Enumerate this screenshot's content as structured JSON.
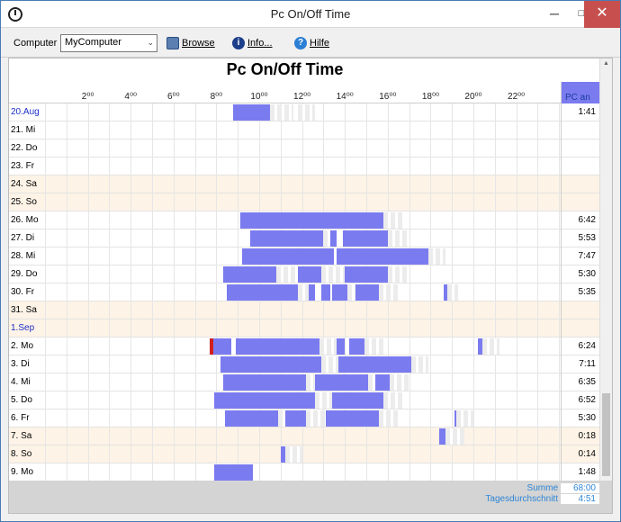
{
  "window": {
    "title": "Pc On/Off Time",
    "min": "─",
    "max": "□",
    "close": "✕"
  },
  "toolbar": {
    "computer_label": "Computer",
    "computer_value": "MyComputer",
    "browse_label": "Browse",
    "info_label": "Info...",
    "help_label": "Hilfe"
  },
  "chart": {
    "title": "Pc On/Off Time",
    "hours": [
      "2⁰⁰",
      "4⁰⁰",
      "6⁰⁰",
      "8⁰⁰",
      "10⁰⁰",
      "12⁰⁰",
      "14⁰⁰",
      "16⁰⁰",
      "18⁰⁰",
      "20⁰⁰",
      "22⁰⁰"
    ],
    "total_header": "PC an",
    "colors": {
      "on": "#7b7bf0",
      "weekend": "#fdf3e6",
      "red": "#d02020"
    },
    "days": [
      {
        "label": "20.Aug",
        "blue": true,
        "weekend": false,
        "total": "1:41",
        "on": [
          [
            8.8,
            10.5
          ]
        ],
        "fade": [
          [
            10.5,
            11.6
          ],
          [
            11.8,
            12.6
          ]
        ],
        "red": []
      },
      {
        "label": "21. Mi",
        "blue": false,
        "weekend": false,
        "total": "",
        "on": [],
        "fade": [],
        "red": []
      },
      {
        "label": "22. Do",
        "blue": false,
        "weekend": false,
        "total": "",
        "on": [],
        "fade": [],
        "red": []
      },
      {
        "label": "23. Fr",
        "blue": false,
        "weekend": false,
        "total": "",
        "on": [],
        "fade": [],
        "red": []
      },
      {
        "label": "24. Sa",
        "blue": false,
        "weekend": true,
        "total": "",
        "on": [],
        "fade": [],
        "red": []
      },
      {
        "label": "25. So",
        "blue": false,
        "weekend": true,
        "total": "",
        "on": [],
        "fade": [],
        "red": []
      },
      {
        "label": "26. Mo",
        "blue": false,
        "weekend": false,
        "total": "6:42",
        "on": [
          [
            9.1,
            15.8
          ]
        ],
        "fade": [
          [
            15.8,
            16.8
          ]
        ],
        "red": []
      },
      {
        "label": "27. Di",
        "blue": false,
        "weekend": false,
        "total": "5:53",
        "on": [
          [
            9.6,
            13.0
          ],
          [
            13.3,
            13.6
          ],
          [
            13.9,
            16.0
          ]
        ],
        "fade": [
          [
            13.0,
            13.3
          ],
          [
            16.0,
            17.0
          ]
        ],
        "red": []
      },
      {
        "label": "28. Mi",
        "blue": false,
        "weekend": false,
        "total": "7:47",
        "on": [
          [
            9.2,
            13.5
          ],
          [
            13.6,
            17.9
          ]
        ],
        "fade": [
          [
            17.9,
            18.7
          ]
        ],
        "red": []
      },
      {
        "label": "29. Do",
        "blue": false,
        "weekend": false,
        "total": "5:30",
        "on": [
          [
            8.3,
            10.8
          ],
          [
            11.8,
            12.9
          ],
          [
            14.0,
            16.0
          ]
        ],
        "fade": [
          [
            10.8,
            11.8
          ],
          [
            12.9,
            14.0
          ],
          [
            16.0,
            16.9
          ]
        ],
        "red": []
      },
      {
        "label": "30. Fr",
        "blue": false,
        "weekend": false,
        "total": "5:35",
        "on": [
          [
            8.5,
            11.8
          ],
          [
            12.3,
            12.6
          ],
          [
            12.9,
            13.3
          ],
          [
            13.4,
            14.1
          ],
          [
            14.5,
            15.6
          ],
          [
            18.6,
            18.8
          ]
        ],
        "fade": [
          [
            11.8,
            12.3
          ],
          [
            14.1,
            14.5
          ],
          [
            15.6,
            16.6
          ],
          [
            18.8,
            19.3
          ]
        ],
        "red": []
      },
      {
        "label": "31. Sa",
        "blue": false,
        "weekend": true,
        "total": "",
        "on": [],
        "fade": [],
        "red": []
      },
      {
        "label": "1.Sep",
        "blue": true,
        "weekend": true,
        "total": "",
        "on": [],
        "fade": [],
        "red": []
      },
      {
        "label": "2. Mo",
        "blue": false,
        "weekend": false,
        "total": "6:24",
        "on": [
          [
            7.8,
            8.7
          ],
          [
            8.9,
            12.8
          ],
          [
            13.6,
            14.0
          ],
          [
            14.2,
            14.9
          ],
          [
            20.2,
            20.4
          ]
        ],
        "fade": [
          [
            12.8,
            13.6
          ],
          [
            14.9,
            15.8
          ],
          [
            20.4,
            21.2
          ]
        ],
        "red": [
          [
            7.7,
            7.8
          ]
        ]
      },
      {
        "label": "3. Di",
        "blue": false,
        "weekend": false,
        "total": "7:11",
        "on": [
          [
            8.2,
            12.9
          ],
          [
            13.7,
            17.1
          ]
        ],
        "fade": [
          [
            12.9,
            13.7
          ],
          [
            17.1,
            17.9
          ]
        ],
        "red": []
      },
      {
        "label": "4. Mi",
        "blue": false,
        "weekend": false,
        "total": "6:35",
        "on": [
          [
            8.3,
            12.2
          ],
          [
            12.6,
            15.1
          ],
          [
            15.4,
            16.1
          ]
        ],
        "fade": [
          [
            12.2,
            12.6
          ],
          [
            15.1,
            15.4
          ],
          [
            16.1,
            17.0
          ]
        ],
        "red": []
      },
      {
        "label": "5. Do",
        "blue": false,
        "weekend": false,
        "total": "6:52",
        "on": [
          [
            7.9,
            12.6
          ],
          [
            13.4,
            15.8
          ]
        ],
        "fade": [
          [
            12.6,
            13.4
          ],
          [
            15.8,
            16.8
          ]
        ],
        "red": []
      },
      {
        "label": "6. Fr",
        "blue": false,
        "weekend": false,
        "total": "5:30",
        "on": [
          [
            8.4,
            10.9
          ],
          [
            11.2,
            12.2
          ],
          [
            13.1,
            15.6
          ],
          [
            19.1,
            19.2
          ]
        ],
        "fade": [
          [
            10.9,
            11.2
          ],
          [
            12.2,
            13.1
          ],
          [
            15.6,
            16.6
          ],
          [
            19.2,
            20.0
          ]
        ],
        "red": []
      },
      {
        "label": "7. Sa",
        "blue": false,
        "weekend": true,
        "total": "0:18",
        "on": [
          [
            18.4,
            18.7
          ]
        ],
        "fade": [
          [
            18.7,
            19.6
          ]
        ],
        "red": []
      },
      {
        "label": "8. So",
        "blue": false,
        "weekend": true,
        "total": "0:14",
        "on": [
          [
            11.0,
            11.2
          ]
        ],
        "fade": [
          [
            11.2,
            12.0
          ]
        ],
        "red": []
      },
      {
        "label": "9. Mo",
        "blue": false,
        "weekend": false,
        "total": "1:48",
        "on": [
          [
            7.9,
            9.7
          ]
        ],
        "fade": [],
        "red": []
      }
    ]
  },
  "summary": {
    "sum_label": "Summe",
    "sum_value": "68:00",
    "avg_label": "Tagesdurchschnitt",
    "avg_value": "4:51"
  }
}
